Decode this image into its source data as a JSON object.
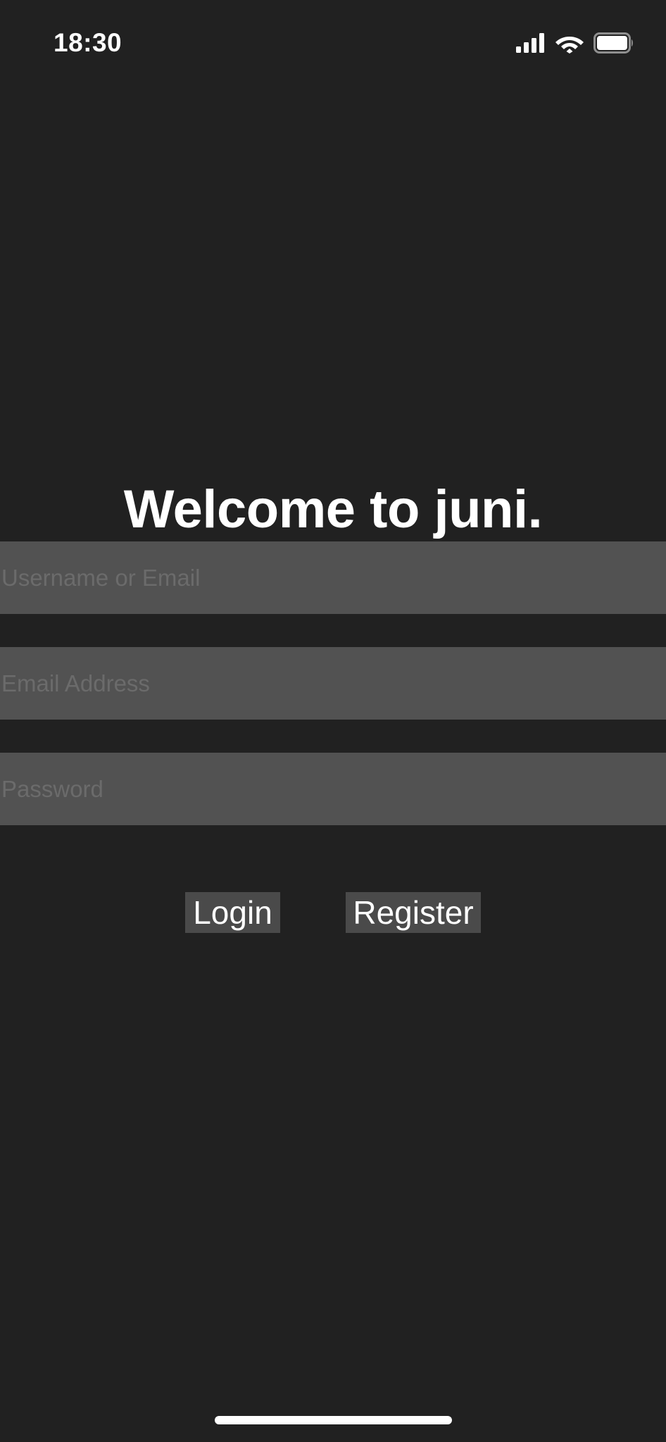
{
  "status_bar": {
    "time": "18:30",
    "icons": [
      "cellular-signal-icon",
      "wifi-icon",
      "battery-icon"
    ]
  },
  "login_screen": {
    "title": "Welcome to juni.",
    "fields": {
      "username": {
        "placeholder": "Username or Email",
        "value": ""
      },
      "email": {
        "placeholder": "Email Address",
        "value": ""
      },
      "password": {
        "placeholder": "Password",
        "value": ""
      }
    },
    "buttons": {
      "login_label": "Login",
      "register_label": "Register"
    }
  },
  "colors": {
    "background": "#212121",
    "field_background": "#525252",
    "button_background": "#4a4a4a",
    "placeholder": "#6b6b6b",
    "text": "#ffffff"
  }
}
